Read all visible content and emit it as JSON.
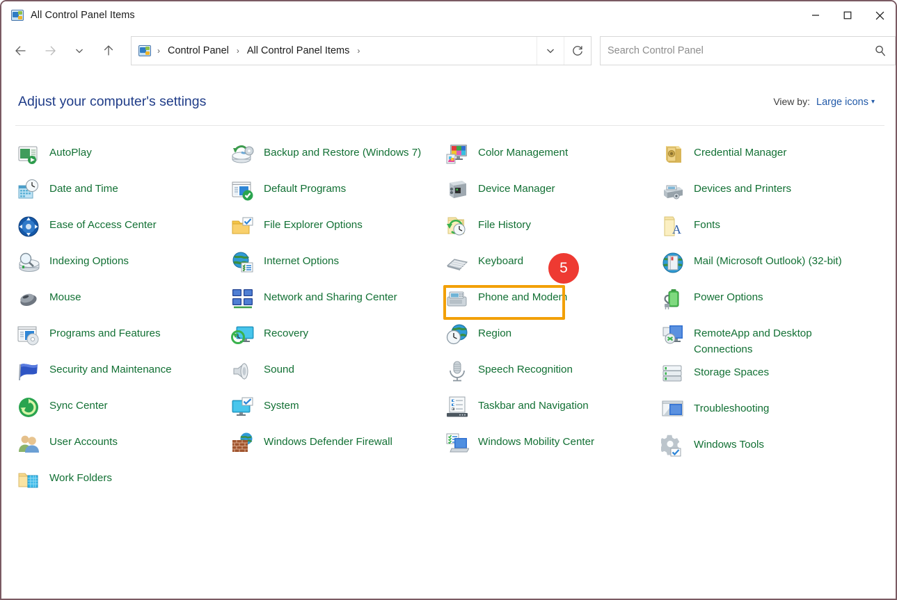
{
  "window": {
    "title": "All Control Panel Items",
    "icon": "control-panel-icon",
    "minimize_label": "—",
    "maximize_label": "☐",
    "close_label": "✕"
  },
  "nav": {
    "back_label": "←",
    "forward_label": "→",
    "recent_label": "∨",
    "up_label": "↑",
    "breadcrumb": [
      "Control Panel",
      "All Control Panel Items"
    ],
    "separator": "›",
    "dropdown_label": "∨",
    "refresh_label": "↻"
  },
  "search": {
    "placeholder": "Search Control Panel",
    "value": "",
    "icon": "search-icon"
  },
  "header": {
    "heading": "Adjust your computer's settings",
    "view_by_label": "View by:",
    "view_by_value": "Large icons",
    "view_by_caret": "▾"
  },
  "annotation": {
    "badge_number": "5",
    "highlight_target": "Keyboard",
    "highlight_color": "#f2a007",
    "badge_color": "#ee3a32"
  },
  "colors": {
    "link_green": "#127034",
    "heading_blue": "#1f3c88",
    "accent_blue": "#2159a8"
  },
  "columns": [
    [
      {
        "label": "AutoPlay",
        "icon": "autoplay-icon"
      },
      {
        "label": "Date and Time",
        "icon": "date-and-time-icon"
      },
      {
        "label": "Ease of Access Center",
        "icon": "ease-of-access-icon"
      },
      {
        "label": "Indexing Options",
        "icon": "indexing-options-icon"
      },
      {
        "label": "Mouse",
        "icon": "mouse-icon"
      },
      {
        "label": "Programs and Features",
        "icon": "programs-and-features-icon"
      },
      {
        "label": "Security and Maintenance",
        "icon": "security-and-maintenance-icon"
      },
      {
        "label": "Sync Center",
        "icon": "sync-center-icon"
      },
      {
        "label": "User Accounts",
        "icon": "user-accounts-icon"
      },
      {
        "label": "Work Folders",
        "icon": "work-folders-icon"
      }
    ],
    [
      {
        "label": "Backup and Restore (Windows 7)",
        "icon": "backup-and-restore-icon"
      },
      {
        "label": "Default Programs",
        "icon": "default-programs-icon"
      },
      {
        "label": "File Explorer Options",
        "icon": "file-explorer-options-icon"
      },
      {
        "label": "Internet Options",
        "icon": "internet-options-icon"
      },
      {
        "label": "Network and Sharing Center",
        "icon": "network-and-sharing-icon"
      },
      {
        "label": "Recovery",
        "icon": "recovery-icon"
      },
      {
        "label": "Sound",
        "icon": "sound-icon"
      },
      {
        "label": "System",
        "icon": "system-icon"
      },
      {
        "label": "Windows Defender Firewall",
        "icon": "windows-defender-firewall-icon"
      }
    ],
    [
      {
        "label": "Color Management",
        "icon": "color-management-icon"
      },
      {
        "label": "Device Manager",
        "icon": "device-manager-icon"
      },
      {
        "label": "File History",
        "icon": "file-history-icon"
      },
      {
        "label": "Keyboard",
        "icon": "keyboard-icon"
      },
      {
        "label": "Phone and Modem",
        "icon": "phone-and-modem-icon"
      },
      {
        "label": "Region",
        "icon": "region-icon"
      },
      {
        "label": "Speech Recognition",
        "icon": "speech-recognition-icon"
      },
      {
        "label": "Taskbar and Navigation",
        "icon": "taskbar-and-navigation-icon"
      },
      {
        "label": "Windows Mobility Center",
        "icon": "windows-mobility-center-icon"
      }
    ],
    [
      {
        "label": "Credential Manager",
        "icon": "credential-manager-icon"
      },
      {
        "label": "Devices and Printers",
        "icon": "devices-and-printers-icon"
      },
      {
        "label": "Fonts",
        "icon": "fonts-icon"
      },
      {
        "label": "Mail (Microsoft Outlook) (32-bit)",
        "icon": "mail-icon"
      },
      {
        "label": "Power Options",
        "icon": "power-options-icon"
      },
      {
        "label": "RemoteApp and Desktop Connections",
        "icon": "remoteapp-icon"
      },
      {
        "label": "Storage Spaces",
        "icon": "storage-spaces-icon"
      },
      {
        "label": "Troubleshooting",
        "icon": "troubleshooting-icon"
      },
      {
        "label": "Windows Tools",
        "icon": "windows-tools-icon"
      }
    ]
  ]
}
